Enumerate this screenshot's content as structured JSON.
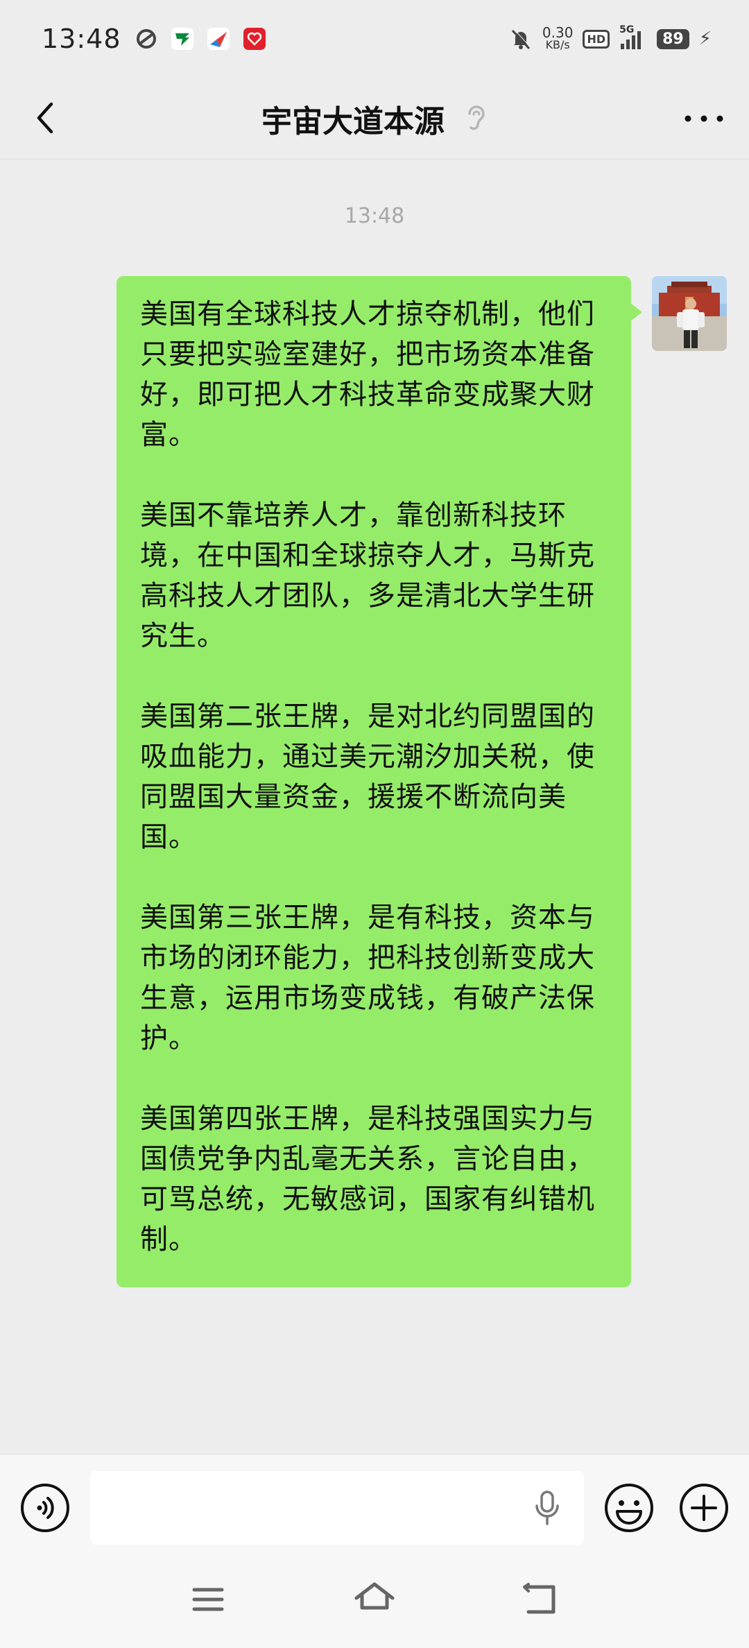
{
  "status_bar": {
    "time": "13:48",
    "net_speed_value": "0.30",
    "net_speed_unit": "KB/s",
    "hd_badge": "HD",
    "network_type": "5G",
    "battery": "89"
  },
  "nav": {
    "title": "宇宙大道本源"
  },
  "chat": {
    "timestamp": "13:48",
    "messages": [
      {
        "sender": "self",
        "paragraphs": [
          "美国有全球科技人才掠夺机制，他们只要把实验室建好，把市场资本准备好，即可把人才科技革命变成聚大财富。",
          "美国不靠培养人才，靠创新科技环境，在中国和全球掠夺人才，马斯克高科技人才团队，多是清北大学生研究生。",
          "美国第二张王牌，是对北约同盟国的吸血能力，通过美元潮汐加关税，使同盟国大量资金，援援不断流向美国。",
          "美国第三张王牌，是有科技，资本与市场的闭环能力，把科技创新变成大生意，运用市场变成钱，有破产法保护。",
          "美国第四张王牌，是科技强国实力与国债党争内乱毫无关系，言论自由，可骂总统，无敏感词，国家有纠错机制。"
        ]
      }
    ]
  },
  "input": {
    "placeholder": ""
  },
  "colors": {
    "background": "#ededed",
    "bubble_self": "#95ec69",
    "input_bar": "#f7f7f7"
  },
  "icons": [
    "back-arrow-icon",
    "ear-icon",
    "more-icon",
    "voice-icon",
    "mic-icon",
    "emoji-icon",
    "plus-icon",
    "menu-icon",
    "home-icon",
    "back-icon"
  ]
}
